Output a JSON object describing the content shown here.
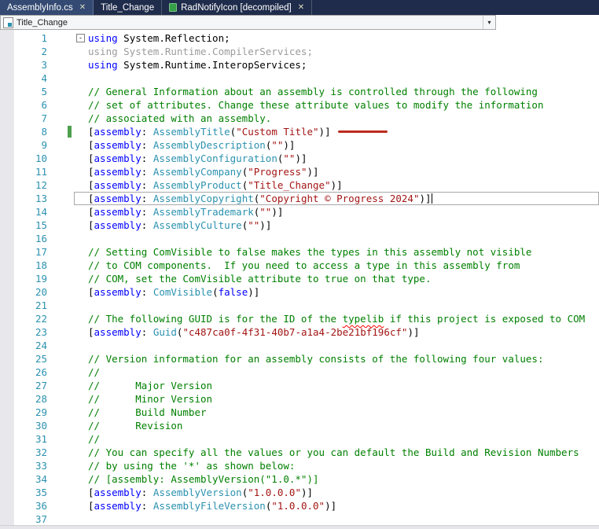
{
  "tabs": [
    {
      "label": "AssemblyInfo.cs",
      "active": true,
      "closable": true
    },
    {
      "label": "Title_Change",
      "active": false,
      "closable": false
    },
    {
      "label": "RadNotifyIcon [decompiled]",
      "active": false,
      "closable": true,
      "icon": "decompiled-document-green"
    }
  ],
  "navigation": {
    "project": "Title_Change"
  },
  "icons": {
    "close": "✕",
    "chevron_down": "▾",
    "collapse_minus": "-"
  },
  "palette": {
    "tabstrip_bg": "#1f2c4b",
    "active_tab_bg": "#344a73",
    "keyword": "#0000ff",
    "type": "#2b91af",
    "string": "#a31515",
    "comment": "#008000",
    "inactive_code": "#9c9c9c",
    "line_number": "#2b91af",
    "change_bar": "#4ea04e",
    "annotation_red": "#bd2a1c"
  },
  "editor": {
    "lines": [
      {
        "fold": true,
        "tokens": [
          [
            "k",
            "using"
          ],
          [
            "d",
            " System.Reflection;"
          ]
        ]
      },
      {
        "tokens": [
          [
            "g",
            "using System.Runtime.CompilerServices;"
          ]
        ]
      },
      {
        "tokens": [
          [
            "k",
            "using"
          ],
          [
            "d",
            " System.Runtime.InteropServices;"
          ]
        ]
      },
      {
        "tokens": []
      },
      {
        "tokens": [
          [
            "c",
            "// General Information about an assembly is controlled through the following"
          ]
        ]
      },
      {
        "tokens": [
          [
            "c",
            "// set of attributes. Change these attribute values to modify the information"
          ]
        ]
      },
      {
        "tokens": [
          [
            "c",
            "// associated with an assembly."
          ]
        ]
      },
      {
        "change": true,
        "red_marker": true,
        "tokens": [
          [
            "d",
            "["
          ],
          [
            "k",
            "assembly"
          ],
          [
            "d",
            ": "
          ],
          [
            "t",
            "AssemblyTitle"
          ],
          [
            "d",
            "("
          ],
          [
            "s",
            "\"Custom Title\""
          ],
          [
            "d",
            ")]"
          ]
        ]
      },
      {
        "tokens": [
          [
            "d",
            "["
          ],
          [
            "k",
            "assembly"
          ],
          [
            "d",
            ": "
          ],
          [
            "t",
            "AssemblyDescription"
          ],
          [
            "d",
            "("
          ],
          [
            "s",
            "\"\""
          ],
          [
            "d",
            ")]"
          ]
        ]
      },
      {
        "tokens": [
          [
            "d",
            "["
          ],
          [
            "k",
            "assembly"
          ],
          [
            "d",
            ": "
          ],
          [
            "t",
            "AssemblyConfiguration"
          ],
          [
            "d",
            "("
          ],
          [
            "s",
            "\"\""
          ],
          [
            "d",
            ")]"
          ]
        ]
      },
      {
        "tokens": [
          [
            "d",
            "["
          ],
          [
            "k",
            "assembly"
          ],
          [
            "d",
            ": "
          ],
          [
            "t",
            "AssemblyCompany"
          ],
          [
            "d",
            "("
          ],
          [
            "s",
            "\"Progress\""
          ],
          [
            "d",
            ")]"
          ]
        ]
      },
      {
        "tokens": [
          [
            "d",
            "["
          ],
          [
            "k",
            "assembly"
          ],
          [
            "d",
            ": "
          ],
          [
            "t",
            "AssemblyProduct"
          ],
          [
            "d",
            "("
          ],
          [
            "s",
            "\"Title_Change\""
          ],
          [
            "d",
            ")]"
          ]
        ]
      },
      {
        "current": true,
        "caret": true,
        "tokens": [
          [
            "d",
            "["
          ],
          [
            "k",
            "assembly"
          ],
          [
            "d",
            ": "
          ],
          [
            "t",
            "AssemblyCopyright"
          ],
          [
            "d",
            "("
          ],
          [
            "s",
            "\"Copyright © Progress 2024\""
          ],
          [
            "d",
            ")]"
          ]
        ]
      },
      {
        "tokens": [
          [
            "d",
            "["
          ],
          [
            "k",
            "assembly"
          ],
          [
            "d",
            ": "
          ],
          [
            "t",
            "AssemblyTrademark"
          ],
          [
            "d",
            "("
          ],
          [
            "s",
            "\"\""
          ],
          [
            "d",
            ")]"
          ]
        ]
      },
      {
        "tokens": [
          [
            "d",
            "["
          ],
          [
            "k",
            "assembly"
          ],
          [
            "d",
            ": "
          ],
          [
            "t",
            "AssemblyCulture"
          ],
          [
            "d",
            "("
          ],
          [
            "s",
            "\"\""
          ],
          [
            "d",
            ")]"
          ]
        ]
      },
      {
        "tokens": []
      },
      {
        "tokens": [
          [
            "c",
            "// Setting ComVisible to false makes the types in this assembly not visible"
          ]
        ]
      },
      {
        "tokens": [
          [
            "c",
            "// to COM components.  If you need to access a type in this assembly from"
          ]
        ]
      },
      {
        "tokens": [
          [
            "c",
            "// COM, set the ComVisible attribute to true on that type."
          ]
        ]
      },
      {
        "tokens": [
          [
            "d",
            "["
          ],
          [
            "k",
            "assembly"
          ],
          [
            "d",
            ": "
          ],
          [
            "t",
            "ComVisible"
          ],
          [
            "d",
            "("
          ],
          [
            "k",
            "false"
          ],
          [
            "d",
            ")]"
          ]
        ]
      },
      {
        "tokens": []
      },
      {
        "tokens": [
          [
            "c",
            "// The following GUID is for the ID of the "
          ],
          [
            "csq",
            "typelib"
          ],
          [
            "c",
            " if this project is exposed to COM"
          ]
        ]
      },
      {
        "tokens": [
          [
            "d",
            "["
          ],
          [
            "k",
            "assembly"
          ],
          [
            "d",
            ": "
          ],
          [
            "t",
            "Guid"
          ],
          [
            "d",
            "("
          ],
          [
            "s",
            "\"c487ca0f-4f31-40b7-a1a4-2be21bf196cf\""
          ],
          [
            "d",
            ")]"
          ]
        ]
      },
      {
        "tokens": []
      },
      {
        "tokens": [
          [
            "c",
            "// Version information for an assembly consists of the following four values:"
          ]
        ]
      },
      {
        "tokens": [
          [
            "c",
            "//"
          ]
        ]
      },
      {
        "tokens": [
          [
            "c",
            "//      Major Version"
          ]
        ]
      },
      {
        "tokens": [
          [
            "c",
            "//      Minor Version"
          ]
        ]
      },
      {
        "tokens": [
          [
            "c",
            "//      Build Number"
          ]
        ]
      },
      {
        "tokens": [
          [
            "c",
            "//      Revision"
          ]
        ]
      },
      {
        "tokens": [
          [
            "c",
            "//"
          ]
        ]
      },
      {
        "tokens": [
          [
            "c",
            "// You can specify all the values or you can default the Build and Revision Numbers"
          ]
        ]
      },
      {
        "tokens": [
          [
            "c",
            "// by using the '*' as shown below:"
          ]
        ]
      },
      {
        "tokens": [
          [
            "c",
            "// [assembly: AssemblyVersion(\"1.0.*\")]"
          ]
        ]
      },
      {
        "tokens": [
          [
            "d",
            "["
          ],
          [
            "k",
            "assembly"
          ],
          [
            "d",
            ": "
          ],
          [
            "t",
            "AssemblyVersion"
          ],
          [
            "d",
            "("
          ],
          [
            "s",
            "\"1.0.0.0\""
          ],
          [
            "d",
            ")]"
          ]
        ]
      },
      {
        "tokens": [
          [
            "d",
            "["
          ],
          [
            "k",
            "assembly"
          ],
          [
            "d",
            ": "
          ],
          [
            "t",
            "AssemblyFileVersion"
          ],
          [
            "d",
            "("
          ],
          [
            "s",
            "\"1.0.0.0\""
          ],
          [
            "d",
            ")]"
          ]
        ]
      },
      {
        "tokens": []
      }
    ]
  }
}
